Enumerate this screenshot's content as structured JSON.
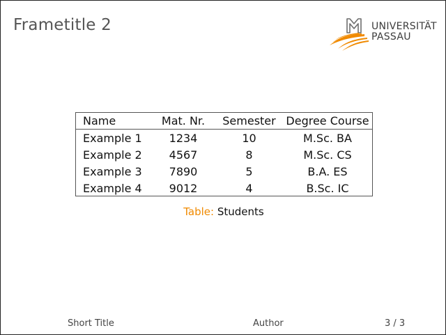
{
  "frame": {
    "title": "Frametitle 2"
  },
  "logo": {
    "line1": "UNIVERSITÄT",
    "line2": "PASSAU",
    "colors": {
      "accent": "#f08a00",
      "mark": "#6e6e6e"
    }
  },
  "table": {
    "headers": [
      "Name",
      "Mat. Nr.",
      "Semester",
      "Degree Course"
    ],
    "rows": [
      [
        "Example 1",
        "1234",
        "10",
        "M.Sc. BA"
      ],
      [
        "Example 2",
        "4567",
        "8",
        "M.Sc. CS"
      ],
      [
        "Example 3",
        "7890",
        "5",
        "B.A. ES"
      ],
      [
        "Example 4",
        "9012",
        "4",
        "B.Sc. IC"
      ]
    ]
  },
  "caption": {
    "label": "Table:",
    "text": "Students",
    "label_color": "#f08a00"
  },
  "footer": {
    "short_title": "Short Title",
    "author": "Author",
    "page": "3 / 3"
  }
}
